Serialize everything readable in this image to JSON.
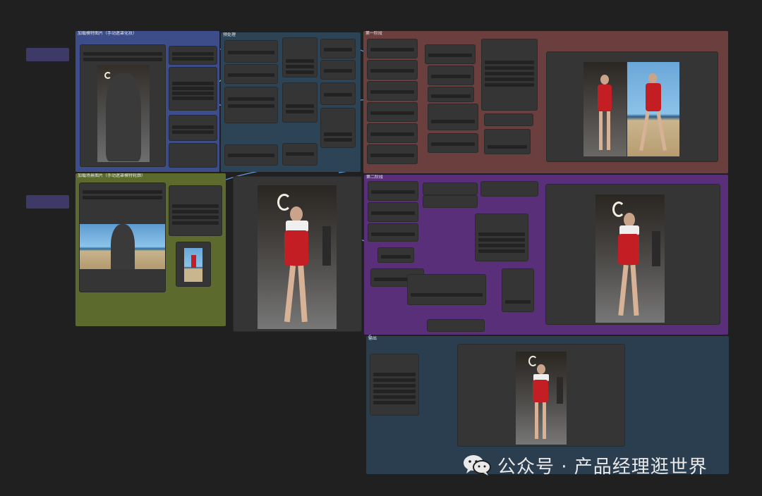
{
  "groups": {
    "load_model": {
      "title": "加载模特图片（手动遮罩化妆）",
      "color": "#3c4d8a"
    },
    "prep": {
      "title": "预处理",
      "color": "#2d4456"
    },
    "stage1": {
      "title": "第一阶段",
      "color": "#6b3f3d"
    },
    "load_scene": {
      "title": "加载场景图片（手动遮罩模特轮廓）",
      "color": "#5d6a2e"
    },
    "stage2": {
      "title": "第二阶段",
      "color": "#5a2f7a"
    },
    "output": {
      "title": "输出",
      "color": "#2b3e4f"
    }
  },
  "colors": {
    "canvas_bg": "#202020",
    "node_bg": "#353535",
    "link_colors": [
      "#6ab1ff",
      "#f6a935",
      "#ff6ed8",
      "#8ce07a",
      "#4fd0ff",
      "#f05454"
    ]
  },
  "watermark": {
    "icon": "wechat-icon",
    "text": "公众号 · 产品经理逛世界"
  }
}
